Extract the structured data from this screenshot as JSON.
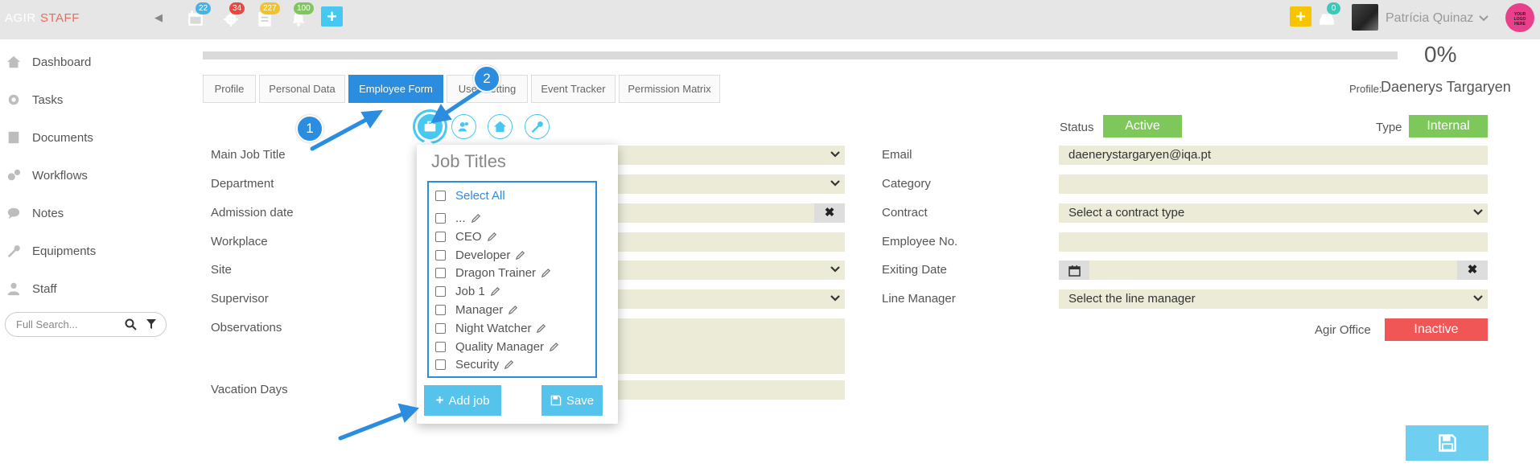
{
  "topbar": {
    "brand_left": "AGIR",
    "brand_right": "STAFF",
    "badges": {
      "calendar": "22",
      "tasks": "34",
      "documents": "227",
      "notifications": "100",
      "messages": "0"
    },
    "user_name": "Patrícia Quinaz",
    "logo_text": "YOUR LOGO HERE"
  },
  "sidebar": {
    "items": [
      {
        "label": "Dashboard",
        "icon": "home-icon"
      },
      {
        "label": "Tasks",
        "icon": "gear-icon"
      },
      {
        "label": "Documents",
        "icon": "document-icon"
      },
      {
        "label": "Workflows",
        "icon": "gears-icon"
      },
      {
        "label": "Notes",
        "icon": "comments-icon"
      },
      {
        "label": "Equipments",
        "icon": "wrench-icon"
      },
      {
        "label": "Staff",
        "icon": "user-icon"
      }
    ],
    "search_placeholder": "Full Search..."
  },
  "progress": {
    "value": 0,
    "label": "0%"
  },
  "tabs": [
    {
      "label": "Profile",
      "active": false
    },
    {
      "label": "Personal Data",
      "active": false
    },
    {
      "label": "Employee Form",
      "active": true
    },
    {
      "label": "User Setting",
      "active": false
    },
    {
      "label": "Event Tracker",
      "active": false
    },
    {
      "label": "Permission Matrix",
      "active": false
    }
  ],
  "profile": {
    "label": "Profile:",
    "name": "Daenerys Targaryen"
  },
  "status": {
    "label": "Status",
    "value": "Active",
    "color": "#7ec85b"
  },
  "type": {
    "label": "Type",
    "value": "Internal",
    "color": "#7ec85b"
  },
  "form_left": {
    "main_job_title": "Main Job Title",
    "department": "Department",
    "admission_date": "Admission date",
    "workplace": "Workplace",
    "site": "Site",
    "supervisor": "Supervisor",
    "observations": "Observations",
    "vacation_days": "Vacation Days"
  },
  "form_right": {
    "email": {
      "label": "Email",
      "value": "daenerystargaryen@iqa.pt"
    },
    "category": {
      "label": "Category",
      "value": ""
    },
    "contract": {
      "label": "Contract",
      "value": "Select a contract type"
    },
    "employee_no": {
      "label": "Employee No.",
      "value": ""
    },
    "exiting_date": {
      "label": "Exiting Date",
      "value": ""
    },
    "line_manager": {
      "label": "Line Manager",
      "value": "Select the line manager"
    },
    "agir_office": {
      "label": "Agir Office",
      "value": "Inactive",
      "color": "#f05656"
    }
  },
  "popover": {
    "title": "Job Titles",
    "select_all": "Select All",
    "items": [
      "...",
      "CEO",
      "Developer",
      "Dragon Trainer",
      "Job 1",
      "Manager",
      "Night Watcher",
      "Quality Manager",
      "Security"
    ],
    "add_button": "Add job",
    "save_button": "Save"
  },
  "annotations": {
    "step1": "1",
    "step2": "2"
  },
  "colors": {
    "accent": "#2b8de0",
    "light_blue": "#46c8f0",
    "field_bg": "#ebebd8"
  }
}
